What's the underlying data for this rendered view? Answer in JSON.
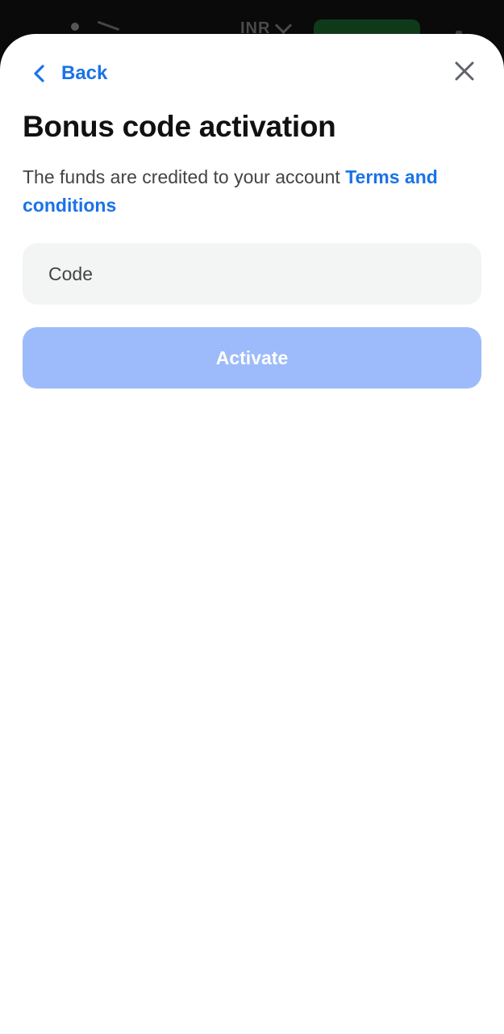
{
  "background": {
    "currency_label": "INR"
  },
  "header": {
    "back_label": "Back"
  },
  "main": {
    "title": "Bonus code activation",
    "description": "The funds are credited to your account",
    "terms_link": "Terms and conditions",
    "code_placeholder": "Code",
    "code_value": "",
    "activate_label": "Activate"
  },
  "colors": {
    "accent": "#1a73e8",
    "button_disabled": "#9dbbfb",
    "field_bg": "#f3f4f4"
  },
  "icons": {
    "back": "chevron-left-icon",
    "close": "close-icon"
  }
}
